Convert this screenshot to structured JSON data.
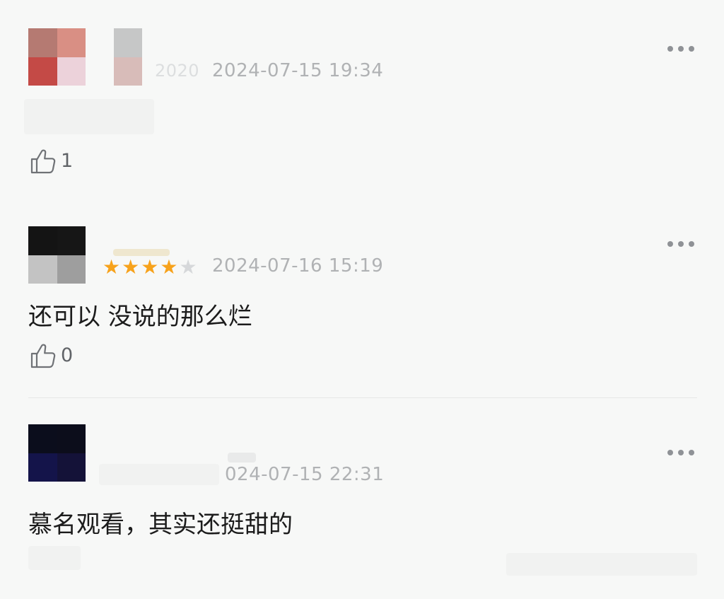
{
  "comments": [
    {
      "name_fragment": "2020",
      "timestamp": "2024-07-15 19:34",
      "text": "",
      "likes": "1",
      "rating": null
    },
    {
      "name_fragment": "",
      "timestamp": "2024-07-16 15:19",
      "text": "还可以 没说的那么烂",
      "likes": "0",
      "rating": 4
    },
    {
      "name_fragment": "",
      "timestamp": "024-07-15 22:31",
      "text": "慕名观看，其实还挺甜的",
      "likes": "",
      "rating": null
    }
  ],
  "rating_max": 5,
  "icons": {
    "more": "more-options-icon",
    "like": "thumbs-up-icon",
    "star": "star-icon"
  },
  "colors": {
    "star_filled": "#f7a21b",
    "star_empty": "#d6d8da",
    "meta_text": "#b0b2b4",
    "body_text": "#1c1c1c"
  }
}
